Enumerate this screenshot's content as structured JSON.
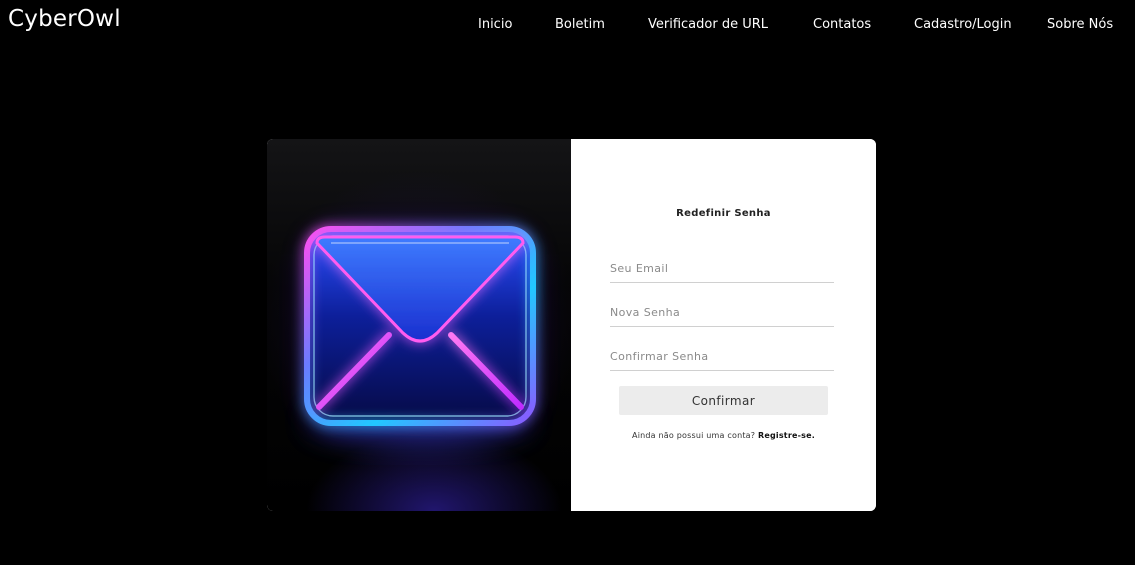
{
  "header": {
    "brand": "CyberOwl",
    "nav": [
      {
        "label": "Inicio"
      },
      {
        "label": "Boletim"
      },
      {
        "label": "Verificador de URL"
      },
      {
        "label": "Contatos"
      },
      {
        "label": "Cadastro/Login"
      },
      {
        "label": "Sobre Nós"
      }
    ]
  },
  "card": {
    "image_icon": "envelope-icon",
    "form": {
      "title": "Redefinir Senha",
      "email_placeholder": "Seu Email",
      "new_password_placeholder": "Nova Senha",
      "confirm_password_placeholder": "Confirmar Senha",
      "confirm_button": "Confirmar",
      "no_account_text": "Ainda não possui uma conta?",
      "register_link": "Registre-se."
    }
  },
  "colors": {
    "background": "#000000",
    "card_form_background": "#ffffff",
    "button_background": "#ececec",
    "neon_blue": "#1e63ff",
    "neon_pink": "#ff3ce6"
  }
}
